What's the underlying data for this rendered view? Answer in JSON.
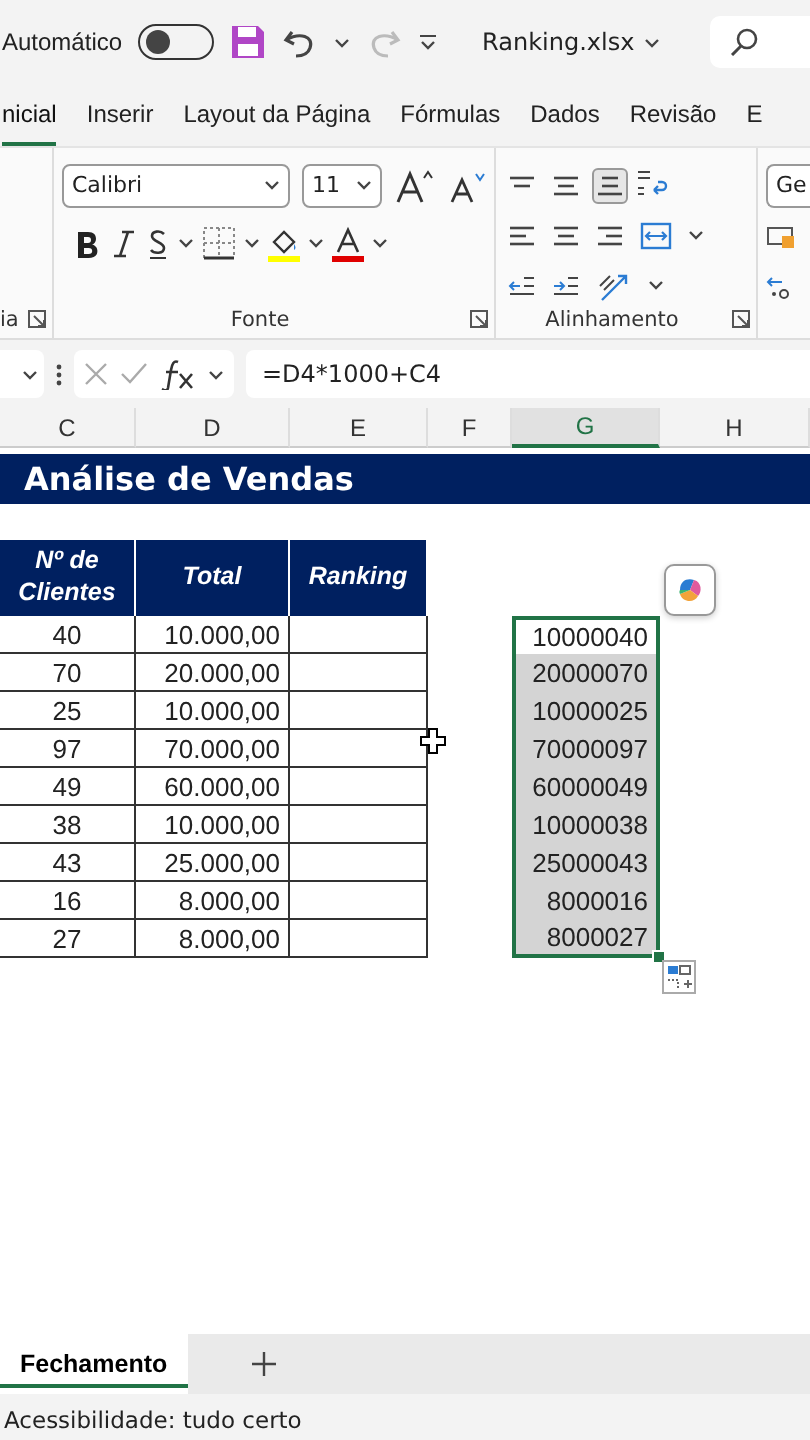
{
  "title_bar": {
    "autosave_label": "Automático",
    "autosave_on": false,
    "file_name": "Ranking.xlsx"
  },
  "ribbon_tabs": [
    {
      "label": "nicial",
      "selected": true
    },
    {
      "label": "Inserir",
      "selected": false
    },
    {
      "label": "Layout da Página",
      "selected": false
    },
    {
      "label": "Fórmulas",
      "selected": false
    },
    {
      "label": "Dados",
      "selected": false
    },
    {
      "label": "Revisão",
      "selected": false
    },
    {
      "label": "E",
      "selected": false
    }
  ],
  "ribbon": {
    "clipboard_group_label": "ia",
    "font_name": "Calibri",
    "font_size": "11",
    "font_group_label": "Fonte",
    "alignment_buttons": [
      {
        "kind": "top",
        "selected": false
      },
      {
        "kind": "middle",
        "selected": false
      },
      {
        "kind": "bottom",
        "selected": true
      }
    ],
    "alignment_group_label": "Alinhamento",
    "number_format": "Ge"
  },
  "formula_bar": {
    "formula": "=D4*1000+C4"
  },
  "columns": [
    {
      "label": "C",
      "selected": false
    },
    {
      "label": "D",
      "selected": false
    },
    {
      "label": "E",
      "selected": false
    },
    {
      "label": "F",
      "selected": false
    },
    {
      "label": "G",
      "selected": true
    },
    {
      "label": "H",
      "selected": false
    }
  ],
  "sheet": {
    "title": "Análise de Vendas",
    "table_headers": [
      "Nº de Clientes",
      "Total",
      "Ranking"
    ],
    "table_rows": [
      [
        "40",
        "10.000,00"
      ],
      [
        "70",
        "20.000,00"
      ],
      [
        "25",
        "10.000,00"
      ],
      [
        "97",
        "70.000,00"
      ],
      [
        "49",
        "60.000,00"
      ],
      [
        "38",
        "10.000,00"
      ],
      [
        "43",
        "25.000,00"
      ],
      [
        "16",
        "8.000,00"
      ],
      [
        "27",
        "8.000,00"
      ]
    ],
    "helper_column": [
      {
        "value": "10000040",
        "active": true
      },
      {
        "value": "20000070",
        "active": false
      },
      {
        "value": "10000025",
        "active": false
      },
      {
        "value": "70000097",
        "active": false
      },
      {
        "value": "60000049",
        "active": false
      },
      {
        "value": "10000038",
        "active": false
      },
      {
        "value": "25000043",
        "active": false
      },
      {
        "value": "8000016",
        "active": false
      },
      {
        "value": "8000027",
        "active": false
      }
    ]
  },
  "sheet_tabs": [
    {
      "label": "Fechamento",
      "selected": true
    }
  ],
  "status_bar": {
    "text": "Acessibilidade: tudo certo"
  }
}
